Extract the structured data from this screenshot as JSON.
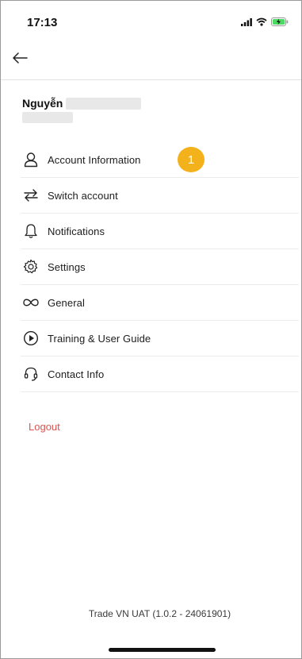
{
  "status_bar": {
    "time": "17:13",
    "icons": [
      "signal-icon",
      "wifi-icon",
      "battery-charging-icon"
    ]
  },
  "nav": {
    "back_icon": "arrow-left-icon"
  },
  "profile": {
    "name": "Nguyễn"
  },
  "menu": {
    "items": [
      {
        "label": "Account Information",
        "icon": "user-icon"
      },
      {
        "label": "Switch account",
        "icon": "switch-arrows-icon"
      },
      {
        "label": "Notifications",
        "icon": "bell-icon"
      },
      {
        "label": "Settings",
        "icon": "gear-icon"
      },
      {
        "label": "General",
        "icon": "infinity-icon"
      },
      {
        "label": "Training & User Guide",
        "icon": "play-circle-icon"
      },
      {
        "label": "Contact Info",
        "icon": "headset-icon"
      }
    ],
    "badge": "1"
  },
  "logout_label": "Logout",
  "version": "Trade VN UAT (1.0.2 - 24061901)",
  "colors": {
    "badge": "#f3b21c",
    "logout": "#d9534f",
    "divider": "#ececec"
  }
}
